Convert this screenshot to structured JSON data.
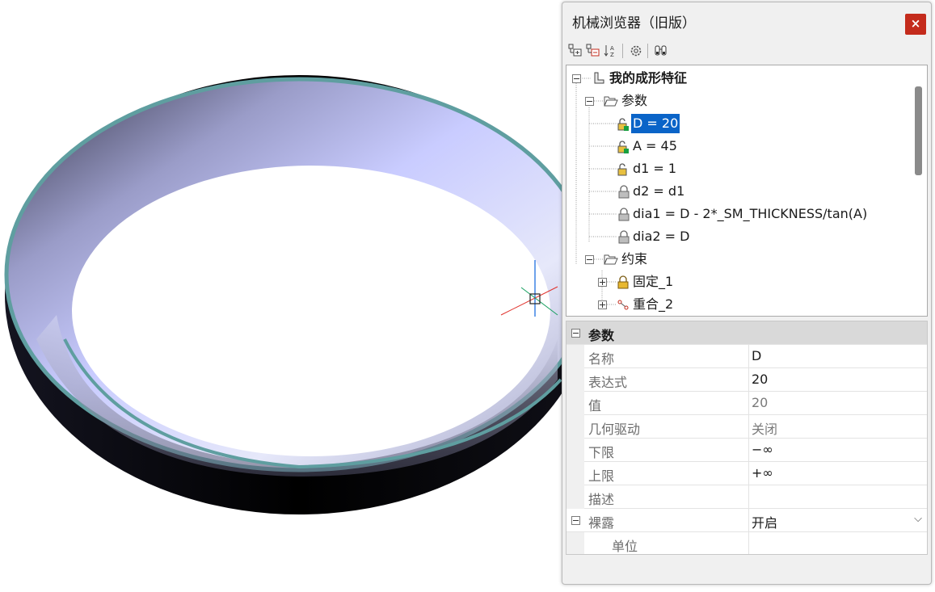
{
  "window": {
    "title": "机械浏览器（旧版）",
    "close_label": "×"
  },
  "toolbar": {
    "icons": [
      "expand-all-icon",
      "collapse-all-icon",
      "sort-az-icon",
      "settings-icon",
      "find-icon"
    ]
  },
  "tree": {
    "root": "我的成形特征",
    "params_folder": "参数",
    "params": [
      "D = 20",
      "A = 45",
      "d1 = 1",
      "d2 = d1",
      "dia1 = D - 2*_SM_THICKNESS/tan(A)",
      "dia2 = D"
    ],
    "constraints_folder": "约束",
    "constraints": [
      "固定_1",
      "重合_2"
    ]
  },
  "properties": {
    "section": "参数",
    "rows": [
      {
        "name": "名称",
        "value": "D"
      },
      {
        "name": "表达式",
        "value": "20"
      },
      {
        "name": "值",
        "value": "20"
      },
      {
        "name": "几何驱动",
        "value": "关闭"
      },
      {
        "name": "下限",
        "value": "−∞"
      },
      {
        "name": "上限",
        "value": "+∞"
      },
      {
        "name": "描述",
        "value": ""
      }
    ],
    "exposed": {
      "name": "裸露",
      "value": "开启"
    },
    "unit": {
      "name": "单位",
      "value": ""
    }
  },
  "colors": {
    "selection": "#0a64c8",
    "close": "#c42b1c",
    "ring_edge": "#5f9ea0"
  }
}
